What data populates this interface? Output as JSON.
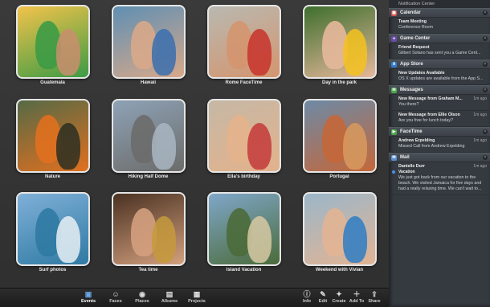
{
  "events": [
    {
      "name": "Guatemala",
      "bg": "#f2c34a",
      "a": "#3d9b45",
      "b": "#c98e6f"
    },
    {
      "name": "Hawaii",
      "bg": "#5f8fb3",
      "a": "#d8a98a",
      "b": "#3a6fae"
    },
    {
      "name": "Rome FaceTime",
      "bg": "#b9b9b0",
      "a": "#d4956f",
      "b": "#c8322c"
    },
    {
      "name": "Day in the park",
      "bg": "#3e6f2e",
      "a": "#e6b89b",
      "b": "#f4c21f"
    },
    {
      "name": "Nature",
      "bg": "#566a46",
      "a": "#e0701f",
      "b": "#2b2f22"
    },
    {
      "name": "Hiking Half Dome",
      "bg": "#8ea2b6",
      "a": "#6c6c6a",
      "b": "#a9b6c2"
    },
    {
      "name": "Ella's birthday",
      "bg": "#c6b8a5",
      "a": "#e3b28c",
      "b": "#c43a3a"
    },
    {
      "name": "Portugal",
      "bg": "#6d8aa6",
      "a": "#c4673a",
      "b": "#d89a5e"
    },
    {
      "name": "Surf photos",
      "bg": "#7fb0d8",
      "a": "#2f7aa3",
      "b": "#e8f0f4"
    },
    {
      "name": "Tea time",
      "bg": "#4a3222",
      "a": "#d3a07e",
      "b": "#c59a3c"
    },
    {
      "name": "Island Vacation",
      "bg": "#7fa7c9",
      "a": "#4b6b3a",
      "b": "#d7c9a3"
    },
    {
      "name": "Weekend with Vivian",
      "bg": "#9bb6c9",
      "a": "#e2b494",
      "b": "#2f7cc3"
    }
  ],
  "toolbar_left": [
    {
      "label": "Events",
      "icon": "▣",
      "active": true
    },
    {
      "label": "Faces",
      "icon": "☺"
    },
    {
      "label": "Places",
      "icon": "◉"
    },
    {
      "label": "Albums",
      "icon": "▤"
    },
    {
      "label": "Projects",
      "icon": "▦"
    }
  ],
  "toolbar_right": [
    {
      "label": "Info",
      "icon": "ⓘ"
    },
    {
      "label": "Edit",
      "icon": "✎"
    },
    {
      "label": "Create",
      "icon": "✦"
    },
    {
      "label": "Add To",
      "icon": "＋"
    },
    {
      "label": "Share",
      "icon": "⇪"
    }
  ],
  "nc": {
    "title": "Notification Center",
    "sections": [
      {
        "name": "Calendar",
        "icon_color": "#d9534f",
        "icon": "▦",
        "items": [
          {
            "title": "Team Meeting",
            "text": "Conference Room",
            "time": ""
          }
        ]
      },
      {
        "name": "Game Center",
        "icon_color": "#6a4aa8",
        "icon": "●",
        "items": [
          {
            "title": "Friend Request",
            "text": "Gilbert Solano has sent you a Game Cent...",
            "time": ""
          }
        ]
      },
      {
        "name": "App Store",
        "icon_color": "#2f7dd3",
        "icon": "A",
        "items": [
          {
            "title": "New Updates Available",
            "text": "OS X updates are available from the App S...",
            "time": ""
          }
        ]
      },
      {
        "name": "Messages",
        "icon_color": "#4aa84a",
        "icon": "✉",
        "items": [
          {
            "title": "New Message from Graham M...",
            "text": "You there?",
            "time": "1m ago"
          },
          {
            "title": "New Message from Ellie Olson",
            "text": "Are you free for lunch today?",
            "time": "1m ago"
          }
        ]
      },
      {
        "name": "FaceTime",
        "icon_color": "#4aa84a",
        "icon": "▶",
        "items": [
          {
            "title": "Andrew Erpelding",
            "text": "Missed Call from Andrew Erpelding",
            "time": "1m ago"
          }
        ]
      },
      {
        "name": "Mail",
        "icon_color": "#5a8fd0",
        "icon": "✉",
        "items": [
          {
            "title": "Danielle Durr",
            "sub": "Vacation",
            "text": "We just got back from our vacation to the beach. We visited Jamaica for five days and had a really relaxing time.  We can't wait to...",
            "time": "1m ago",
            "unread": true
          }
        ]
      }
    ]
  }
}
